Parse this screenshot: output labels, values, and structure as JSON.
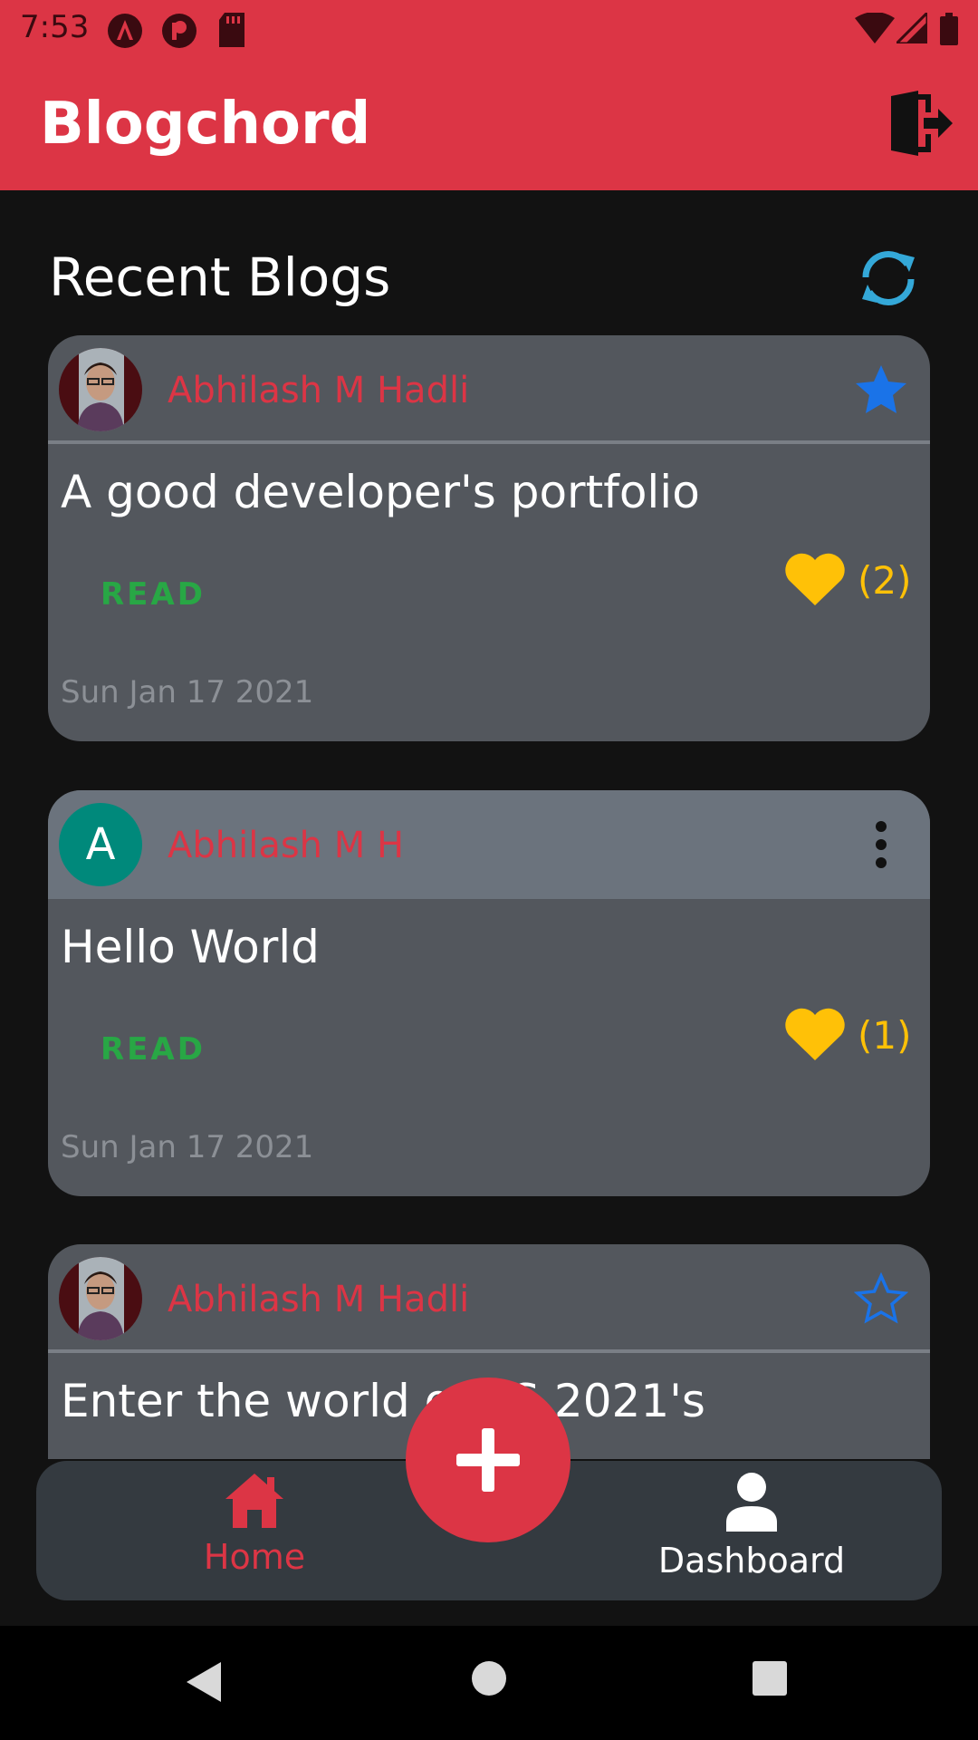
{
  "status_bar": {
    "time": "7:53",
    "icons": [
      "angular-icon",
      "react-icon",
      "sd-card-icon",
      "wifi-icon",
      "signal-icon",
      "battery-icon"
    ]
  },
  "app_bar": {
    "title": "Blogchord",
    "logout_icon": "logout-icon"
  },
  "section": {
    "title": "Recent Blogs",
    "refresh_icon": "refresh-icon"
  },
  "colors": {
    "primary": "#dc3545",
    "read": "#28a745",
    "like": "#ffc107",
    "star": "#1a73e8",
    "card": "#53575d",
    "nav": "#343a40"
  },
  "posts": [
    {
      "author": "Abhilash M Hadli",
      "avatar": "photo",
      "title": "A good developer's portfolio",
      "read_label": "READ",
      "likes": "(2)",
      "date": "Sun Jan 17 2021",
      "action": "star-filled"
    },
    {
      "author": "Abhilash M H",
      "avatar": "A",
      "title": "Hello World",
      "read_label": "READ",
      "likes": "(1)",
      "date": "Sun Jan 17 2021",
      "action": "more-vert"
    },
    {
      "author": "Abhilash M Hadli",
      "avatar": "photo",
      "title": "Enter the world of ES 2021's",
      "action": "star-outline"
    }
  ],
  "bottom_nav": {
    "home": "Home",
    "dashboard": "Dashboard",
    "fab_icon": "plus-icon"
  }
}
